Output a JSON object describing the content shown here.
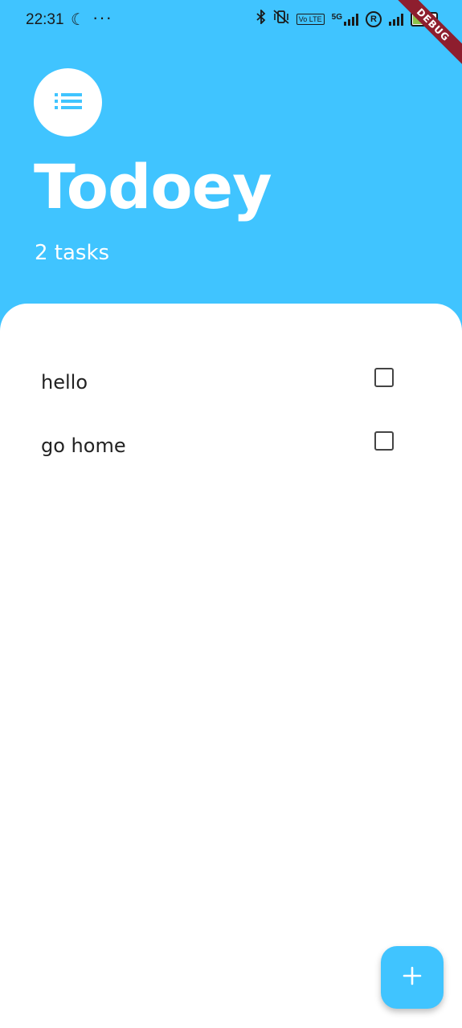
{
  "status_bar": {
    "time": "22:31",
    "moon_icon": "moon-icon",
    "more_dots": "···",
    "battery_level": "61",
    "network_5g": "5G",
    "volte": "Vo LTE",
    "roaming": "R"
  },
  "debug_banner": {
    "label": "DEBUG"
  },
  "header": {
    "menu_icon": "list-icon",
    "title": "Todoey",
    "task_count": "2 tasks"
  },
  "tasks": [
    {
      "title": "hello",
      "checked": false
    },
    {
      "title": "go home",
      "checked": false
    }
  ],
  "fab": {
    "icon": "plus-icon"
  },
  "colors": {
    "accent": "#40C4FF",
    "sheet": "#FFFFFF",
    "debug": "#8E1E2E"
  }
}
